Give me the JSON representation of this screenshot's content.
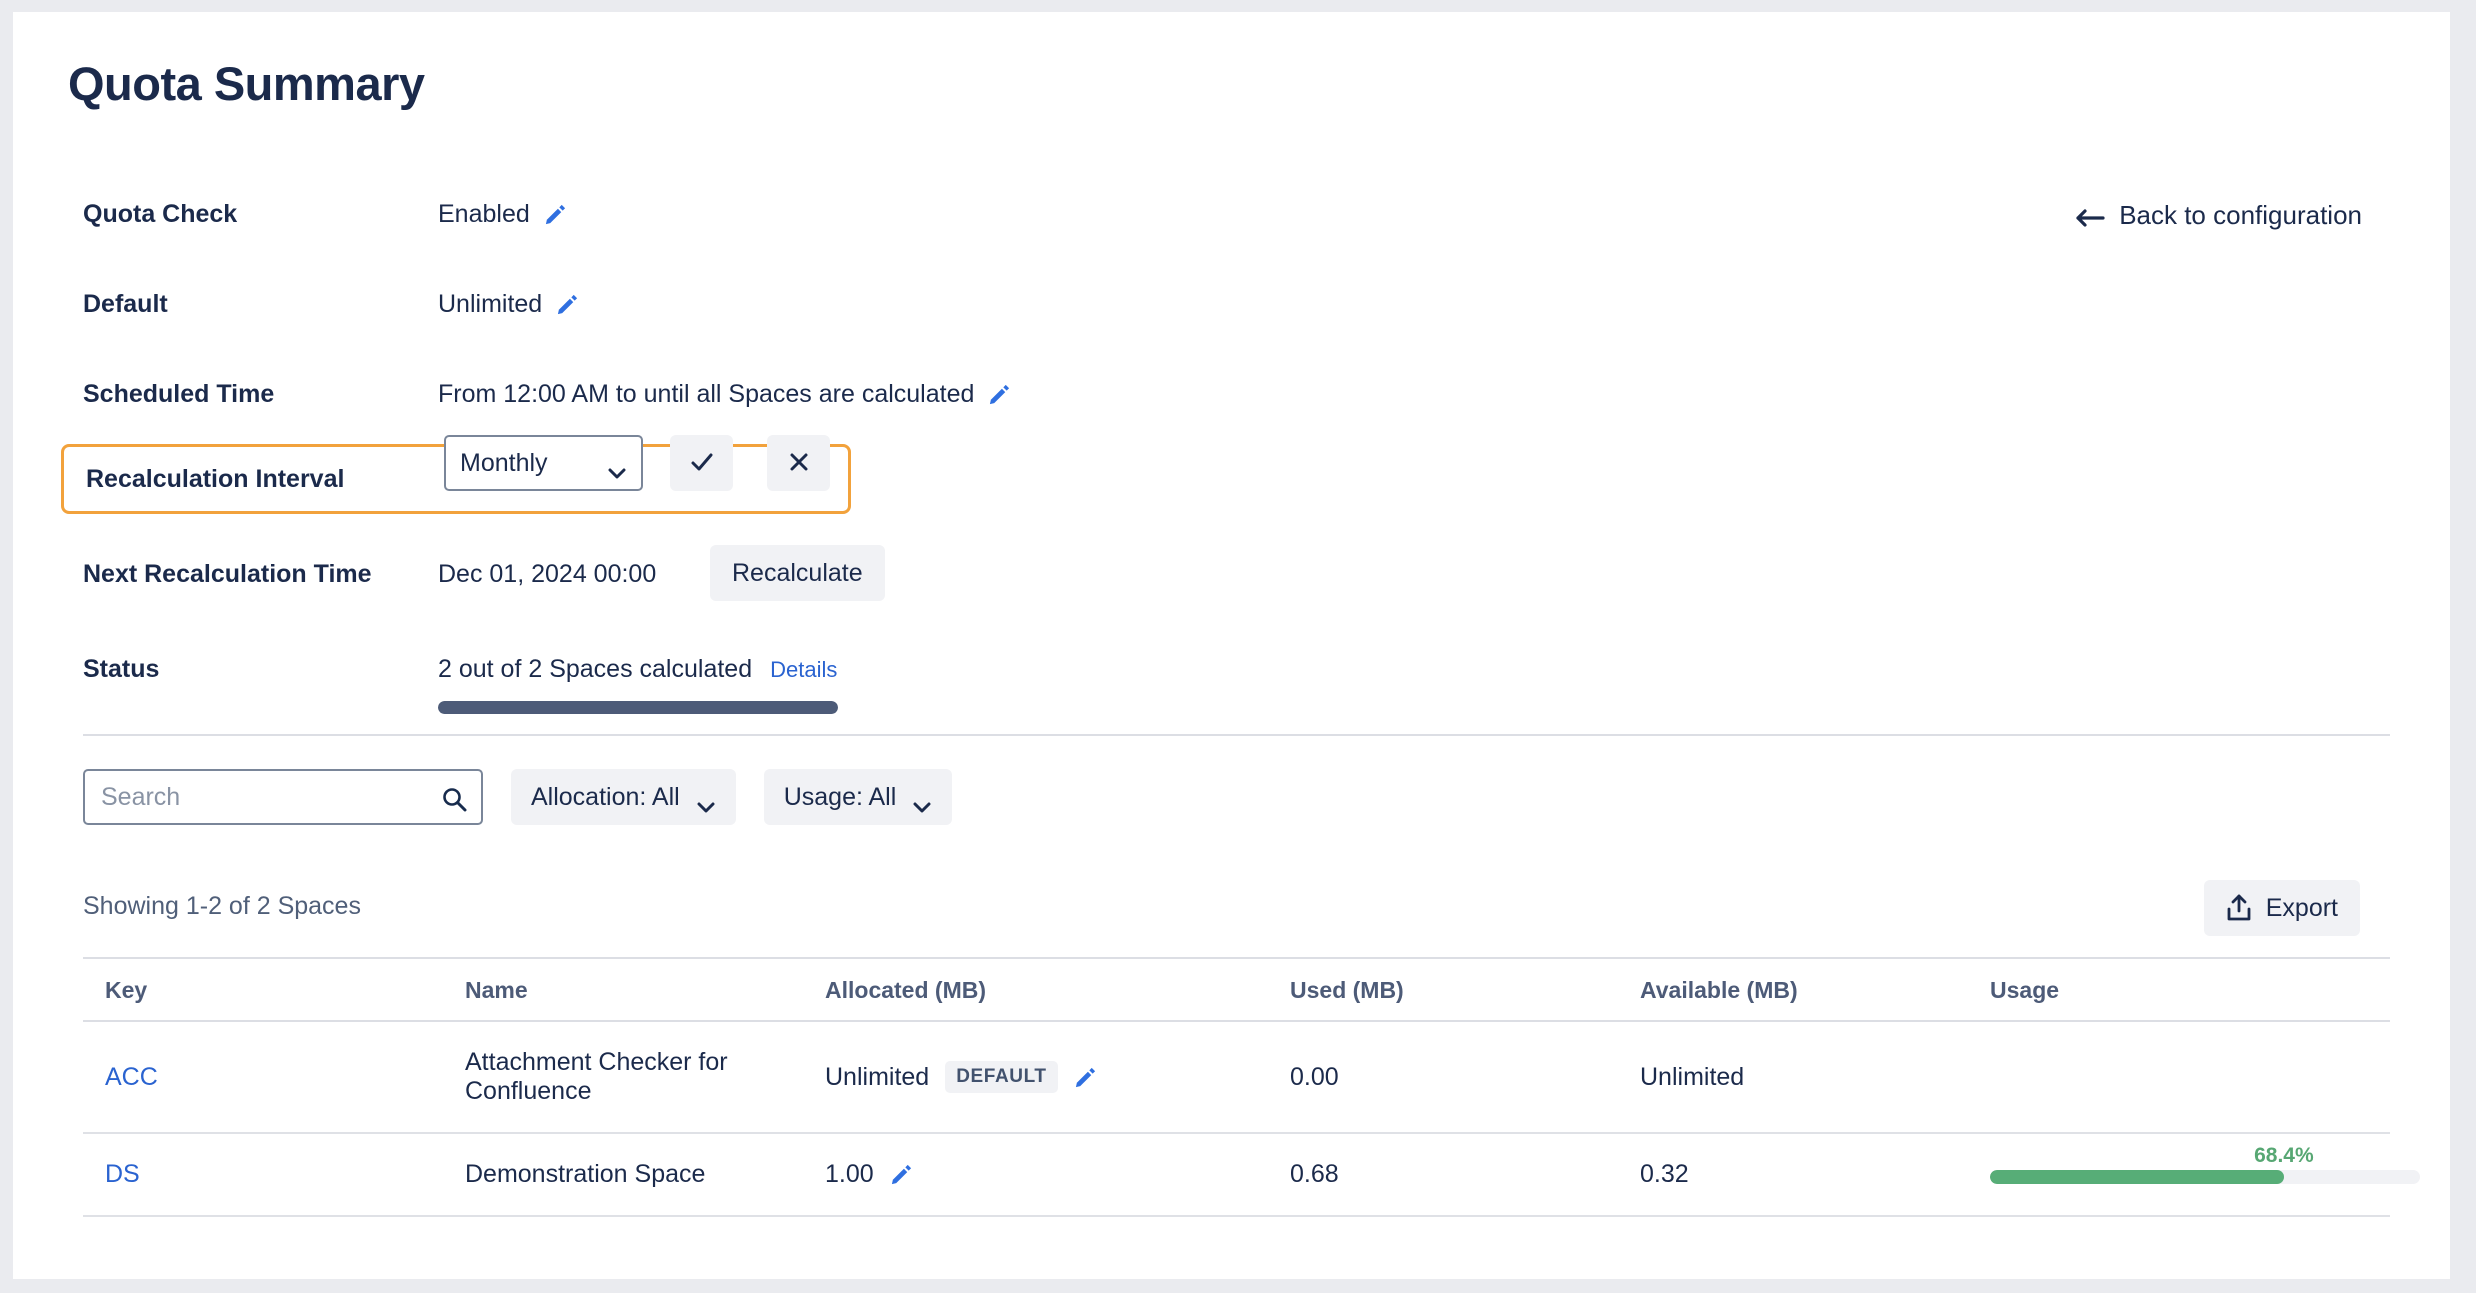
{
  "page": {
    "title": "Quota Summary",
    "back_link": "Back to configuration"
  },
  "summary": {
    "quota_check": {
      "label": "Quota Check",
      "value": "Enabled"
    },
    "default": {
      "label": "Default",
      "value": "Unlimited"
    },
    "scheduled_time": {
      "label": "Scheduled Time",
      "value": "From 12:00 AM to until all Spaces are calculated"
    },
    "recalculation_interval": {
      "label": "Recalculation Interval",
      "value": "Monthly",
      "options": [
        "Monthly"
      ],
      "highlight_color": "#f2a23c"
    },
    "next_recalculation": {
      "label": "Next Recalculation Time",
      "value": "Dec 01, 2024 00:00",
      "button": "Recalculate"
    },
    "status": {
      "label": "Status",
      "value": "2 out of 2 Spaces calculated",
      "details_link": "Details",
      "progress_percent": 100,
      "progress_color": "#4d5b78"
    }
  },
  "filters": {
    "search_placeholder": "Search",
    "search_value": "",
    "allocation": "Allocation: All",
    "usage": "Usage: All"
  },
  "list": {
    "showing": "Showing 1-2 of 2 Spaces",
    "export_label": "Export"
  },
  "table": {
    "columns": [
      "Key",
      "Name",
      "Allocated  (MB)",
      "Used  (MB)",
      "Available  (MB)",
      "Usage"
    ],
    "rows": [
      {
        "key": "ACC",
        "name": "Attachment Checker for Confluence",
        "allocated": "Unlimited",
        "allocated_badge": "DEFAULT",
        "used": "0.00",
        "available": "Unlimited",
        "usage_label": "",
        "usage_percent": null
      },
      {
        "key": "DS",
        "name": "Demonstration Space",
        "allocated": "1.00",
        "allocated_badge": "",
        "used": "0.68",
        "available": "0.32",
        "usage_label": "68.4%",
        "usage_percent": 68.4
      }
    ]
  },
  "colors": {
    "text_primary": "#1b2a4b",
    "link": "#2a63d0",
    "usage_green": "#57ad77",
    "highlight_orange": "#f2a23c"
  }
}
